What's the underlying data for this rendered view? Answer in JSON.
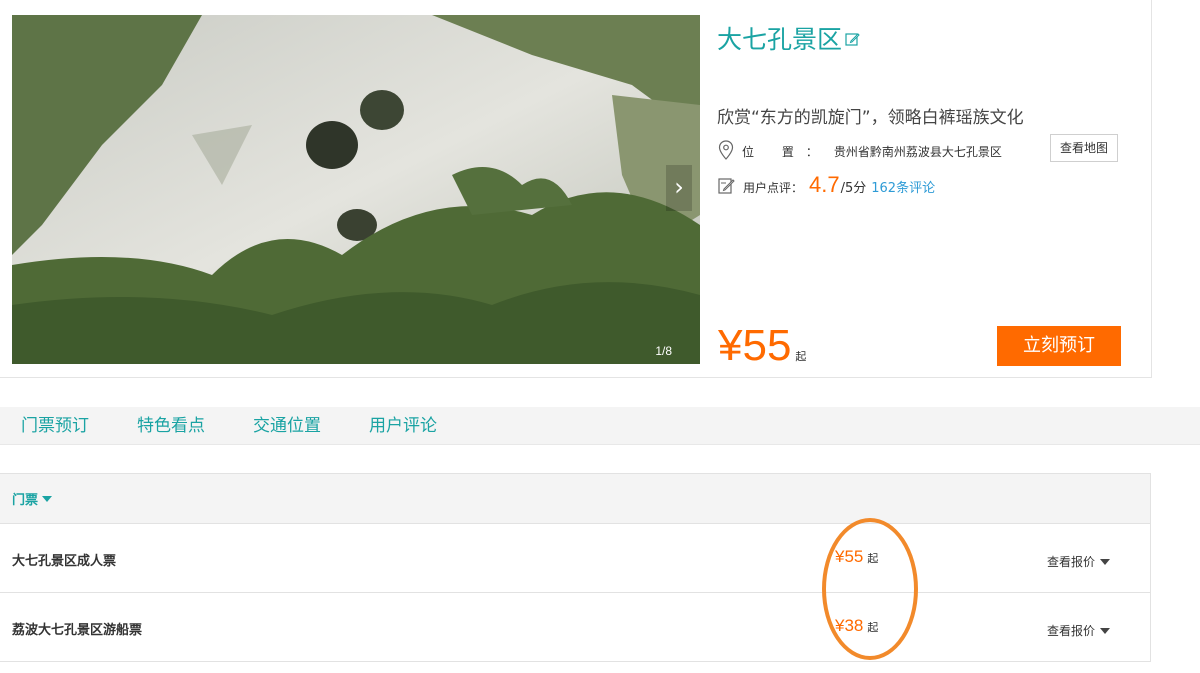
{
  "gallery": {
    "counter": "1/8",
    "next_icon": "chevron-right-icon"
  },
  "scenic": {
    "name": "大七孔景区",
    "edit_icon": "edit-icon",
    "slogan": "欣赏“东方的凯旋门”，领略白裤瑶族文化",
    "location_label": "位 置：",
    "location_value": "贵州省黔南州荔波县大七孔景区",
    "map_button": "查看地图",
    "rating_label": "用户点评：",
    "rating_score": "4.7",
    "rating_max": "/5分",
    "review_link": "162条评论",
    "price_amount": "¥55",
    "price_suffix": "起",
    "book_button": "立刻预订"
  },
  "tabs": [
    {
      "label": "门票预订"
    },
    {
      "label": "特色看点"
    },
    {
      "label": "交通位置"
    },
    {
      "label": "用户评论"
    }
  ],
  "tickets": {
    "header": "门票",
    "rows": [
      {
        "name": "大七孔景区成人票",
        "price": "¥55",
        "suffix": "起",
        "action": "查看报价"
      },
      {
        "name": "荔波大七孔景区游船票",
        "price": "¥38",
        "suffix": "起",
        "action": "查看报价"
      }
    ]
  },
  "colors": {
    "accent": "#1aa3a3",
    "price": "#ff6a00",
    "link": "#2e9bd6",
    "highlight": "#f28a2b"
  }
}
